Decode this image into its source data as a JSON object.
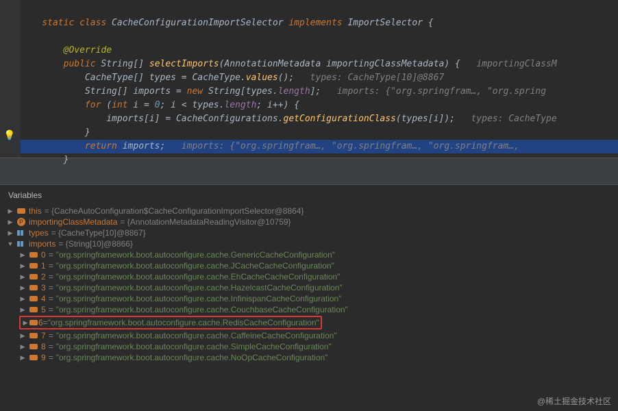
{
  "code": {
    "l1": "static class CacheConfigurationImportSelector implements ImportSelector {",
    "l2": "@Override",
    "l3a": "public String[] ",
    "l3b": "selectImports",
    "l3c": "(AnnotationMetadata importingClassMetadata) {   ",
    "l3d": "importingClassM",
    "l4a": "CacheType[] types = CacheType.",
    "l4b": "values",
    "l4c": "();   ",
    "l4d": "types: CacheType[10]@8867",
    "l5a": "String[] imports = ",
    "l5b": "new",
    "l5c": " String[types.",
    "l5d": "length",
    "l5e": "];   ",
    "l5f": "imports: {\"org.springfram…, \"org.spring",
    "l6a": "for (",
    "l6b": "int",
    "l6c": " i = ",
    "l6d": "0",
    "l6e": "; i < types.",
    "l6f": "length",
    "l6g": "; i++) {",
    "l7a": "imports[i] = CacheConfigurations.",
    "l7b": "getConfigurationClass",
    "l7c": "(types[i]);   ",
    "l7d": "types: CacheType",
    "l8": "}",
    "l9a": "return",
    "l9b": " imports;   ",
    "l9c": "imports: {\"org.springfram…, \"org.springfram…, \"org.springfram…, ",
    "l10": "}"
  },
  "vars": {
    "title": "Variables",
    "this_name": "this",
    "this_val": " = {CacheAutoConfiguration$CacheConfigurationImportSelector@8864}",
    "meta_name": "importingClassMetadata",
    "meta_val": " = {AnnotationMetadataReadingVisitor@10759}",
    "types_name": "types",
    "types_val": " = {CacheType[10]@8867}",
    "imports_name": "imports",
    "imports_val": " = {String[10]@8866}",
    "items": [
      {
        "idx": "0",
        "val": "\"org.springframework.boot.autoconfigure.cache.GenericCacheConfiguration\""
      },
      {
        "idx": "1",
        "val": "\"org.springframework.boot.autoconfigure.cache.JCacheCacheConfiguration\""
      },
      {
        "idx": "2",
        "val": "\"org.springframework.boot.autoconfigure.cache.EhCacheCacheConfiguration\""
      },
      {
        "idx": "3",
        "val": "\"org.springframework.boot.autoconfigure.cache.HazelcastCacheConfiguration\""
      },
      {
        "idx": "4",
        "val": "\"org.springframework.boot.autoconfigure.cache.InfinispanCacheConfiguration\""
      },
      {
        "idx": "5",
        "val": "\"org.springframework.boot.autoconfigure.cache.CouchbaseCacheConfiguration\""
      },
      {
        "idx": "6",
        "val": "\"org.springframework.boot.autoconfigure.cache.RedisCacheConfiguration\""
      },
      {
        "idx": "7",
        "val": "\"org.springframework.boot.autoconfigure.cache.CaffeineCacheConfiguration\""
      },
      {
        "idx": "8",
        "val": "\"org.springframework.boot.autoconfigure.cache.SimpleCacheConfiguration\""
      },
      {
        "idx": "9",
        "val": "\"org.springframework.boot.autoconfigure.cache.NoOpCacheConfiguration\""
      }
    ]
  },
  "watermark": "@稀土掘金技术社区"
}
